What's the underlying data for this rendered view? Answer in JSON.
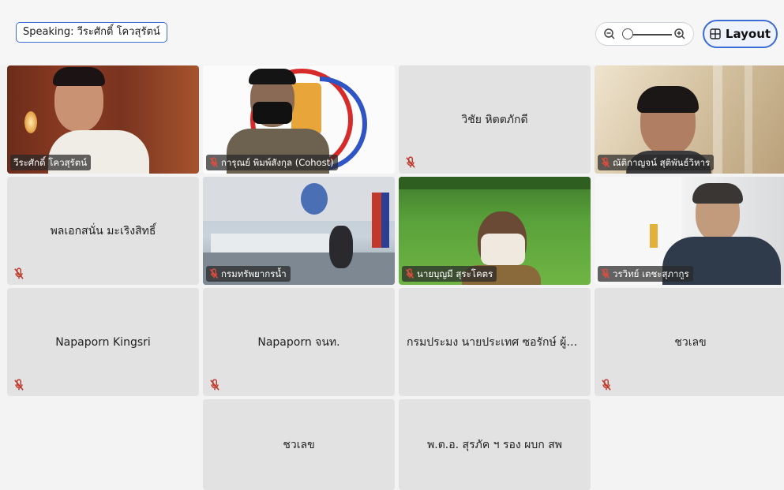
{
  "header": {
    "speaking": "Speaking: วีระศักดิ์ โควสุรัตน์",
    "layout_label": "Layout"
  },
  "tiles": [
    {
      "name": "วีระศักดิ์ โควสุรัตน์",
      "type": "video"
    },
    {
      "name": "การุณย์ พิมพ์สังกุล (Cohost)",
      "type": "video"
    },
    {
      "name": "วิชัย หิตตภักดี",
      "type": "avatar"
    },
    {
      "name": "ณัติกาญจน์ สุติพันธ์วิหาร",
      "type": "video"
    },
    {
      "name": "พลเอกสนั่น มะเริงสิทธิ์",
      "type": "avatar"
    },
    {
      "name": "กรมทรัพยากรน้ำ",
      "type": "video"
    },
    {
      "name": "นายบุญมี สุระโคตร",
      "type": "video"
    },
    {
      "name": "วรวิทย์ เตชะสุภากูร",
      "type": "video"
    },
    {
      "name": "Napaporn Kingsri",
      "type": "avatar"
    },
    {
      "name": "Napaporn จนท.",
      "type": "avatar"
    },
    {
      "name": "กรมประมง นายประเทศ ซอรักษ์ ผู้ต...",
      "type": "avatar"
    },
    {
      "name": "ชวเลข",
      "type": "avatar"
    },
    {
      "name": "ชวเลข",
      "type": "avatar"
    },
    {
      "name": "พ.ต.อ. สุรภัค ฯ รอง ผบก สพ",
      "type": "avatar"
    }
  ],
  "colors": {
    "accent": "#3a6bd6",
    "tile_bg": "#e2e2e3",
    "muted_mic": "#c0392b"
  },
  "icons": [
    "zoom-out-icon",
    "zoom-in-icon",
    "layout-grid-icon",
    "muted-mic-icon"
  ]
}
